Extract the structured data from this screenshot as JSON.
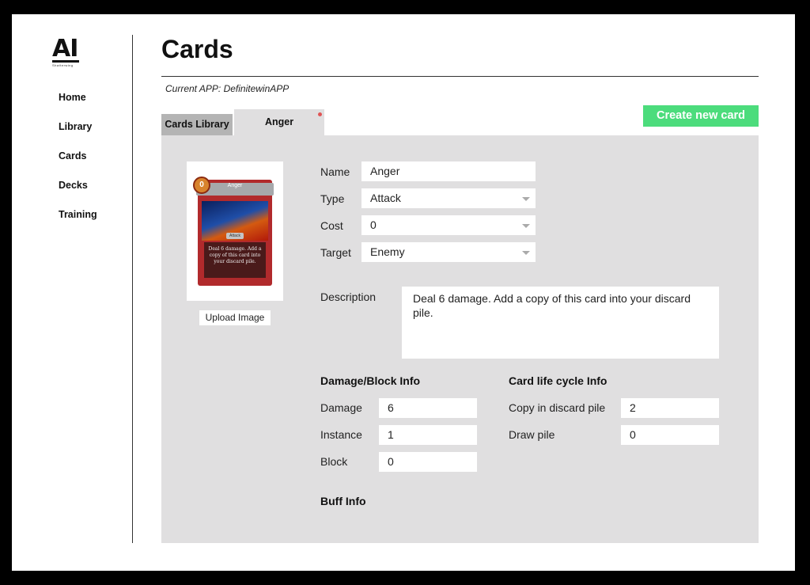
{
  "logo": {
    "text": "AI",
    "subtext": "Shatterwing"
  },
  "nav": {
    "items": [
      "Home",
      "Library",
      "Cards",
      "Decks",
      "Training"
    ]
  },
  "page": {
    "title": "Cards",
    "current_app": "Current APP: DefinitewinAPP"
  },
  "tabs": [
    {
      "label": "Cards Library"
    },
    {
      "label": "Anger"
    }
  ],
  "actions": {
    "create_label": "Create new card"
  },
  "card_preview": {
    "name": "Anger",
    "cost": "0",
    "type": "Attack",
    "description": "Deal 6 damage. Add a copy of this card into your discard pile.",
    "upload_label": "Upload Image"
  },
  "form": {
    "name_label": "Name",
    "name_value": "Anger",
    "type_label": "Type",
    "type_value": "Attack",
    "cost_label": "Cost",
    "cost_value": "0",
    "target_label": "Target",
    "target_value": "Enemy",
    "description_label": "Description",
    "description_value": "Deal 6 damage. Add a copy of this card into your discard pile."
  },
  "damage_block": {
    "title": "Damage/Block Info",
    "damage_label": "Damage",
    "damage_value": "6",
    "instance_label": "Instance",
    "instance_value": "1",
    "block_label": "Block",
    "block_value": "0"
  },
  "lifecycle": {
    "title": "Card life cycle Info",
    "discard_label": "Copy in discard pile",
    "discard_value": "2",
    "draw_label": "Draw pile",
    "draw_value": "0"
  },
  "buff": {
    "title": "Buff Info"
  },
  "colors": {
    "accent": "#4cdc7c",
    "panel": "#e0dfe0",
    "tab_inactive": "#b4b4b4",
    "card_red": "#b12a2c"
  }
}
